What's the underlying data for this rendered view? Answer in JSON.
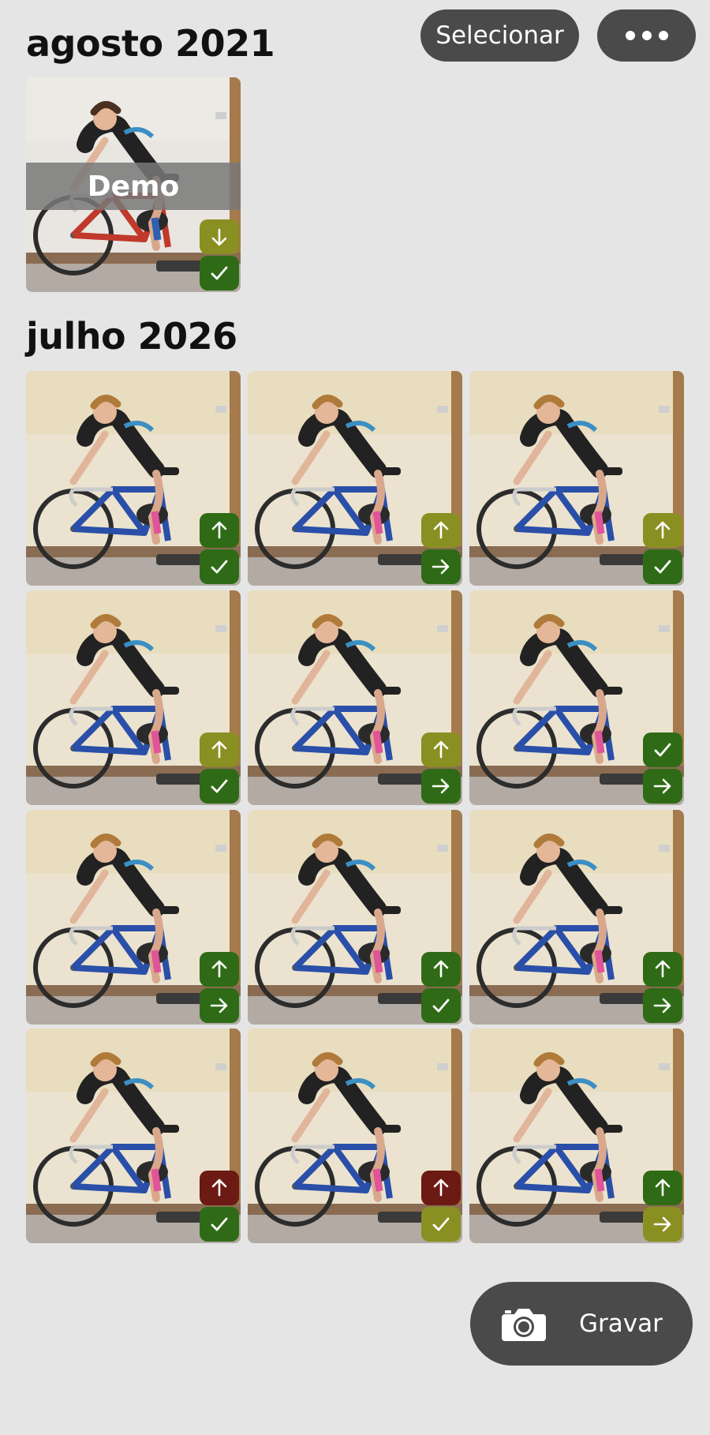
{
  "toolbar": {
    "select_label": "Selecionar",
    "more_icon": "ellipsis-icon"
  },
  "sections": [
    {
      "title": "agosto 2021",
      "videos": [
        {
          "label": "Demo",
          "rider": "man-red-bike",
          "badges": [
            {
              "icon": "arrow-down",
              "color": "#8a8f22"
            },
            {
              "icon": "check",
              "color": "#2f6b16"
            }
          ]
        }
      ]
    },
    {
      "title": "julho 2026",
      "videos": [
        {
          "rider": "woman-blue-bike",
          "badges": [
            {
              "icon": "arrow-up",
              "color": "#2f6b16"
            },
            {
              "icon": "check",
              "color": "#2f6b16"
            }
          ]
        },
        {
          "rider": "woman-blue-bike",
          "badges": [
            {
              "icon": "arrow-up",
              "color": "#8a8f22"
            },
            {
              "icon": "arrow-right",
              "color": "#2f6b16"
            }
          ]
        },
        {
          "rider": "woman-blue-bike",
          "badges": [
            {
              "icon": "arrow-up",
              "color": "#8a8f22"
            },
            {
              "icon": "check",
              "color": "#2f6b16"
            }
          ]
        },
        {
          "rider": "woman-blue-bike",
          "badges": [
            {
              "icon": "arrow-up",
              "color": "#8a8f22"
            },
            {
              "icon": "check",
              "color": "#2f6b16"
            }
          ]
        },
        {
          "rider": "woman-blue-bike",
          "badges": [
            {
              "icon": "arrow-up",
              "color": "#8a8f22"
            },
            {
              "icon": "arrow-right",
              "color": "#2f6b16"
            }
          ]
        },
        {
          "rider": "woman-blue-bike",
          "badges": [
            {
              "icon": "check",
              "color": "#2f6b16"
            },
            {
              "icon": "arrow-right",
              "color": "#2f6b16"
            }
          ]
        },
        {
          "rider": "woman-blue-bike",
          "badges": [
            {
              "icon": "arrow-up",
              "color": "#2f6b16"
            },
            {
              "icon": "arrow-right",
              "color": "#2f6b16"
            }
          ]
        },
        {
          "rider": "woman-blue-bike",
          "badges": [
            {
              "icon": "arrow-up",
              "color": "#2f6b16"
            },
            {
              "icon": "check",
              "color": "#2f6b16"
            }
          ]
        },
        {
          "rider": "woman-blue-bike",
          "badges": [
            {
              "icon": "arrow-up",
              "color": "#2f6b16"
            },
            {
              "icon": "arrow-right",
              "color": "#2f6b16"
            }
          ]
        },
        {
          "rider": "woman-blue-bike",
          "badges": [
            {
              "icon": "arrow-up",
              "color": "#6b1a14"
            },
            {
              "icon": "check",
              "color": "#2f6b16"
            }
          ]
        },
        {
          "rider": "woman-blue-bike",
          "badges": [
            {
              "icon": "arrow-up",
              "color": "#6b1a14"
            },
            {
              "icon": "check",
              "color": "#8a8f22"
            }
          ]
        },
        {
          "rider": "woman-blue-bike",
          "badges": [
            {
              "icon": "arrow-up",
              "color": "#2f6b16"
            },
            {
              "icon": "arrow-right",
              "color": "#8a8f22"
            }
          ]
        }
      ]
    }
  ],
  "record": {
    "label": "Gravar",
    "icon": "camera-icon"
  }
}
